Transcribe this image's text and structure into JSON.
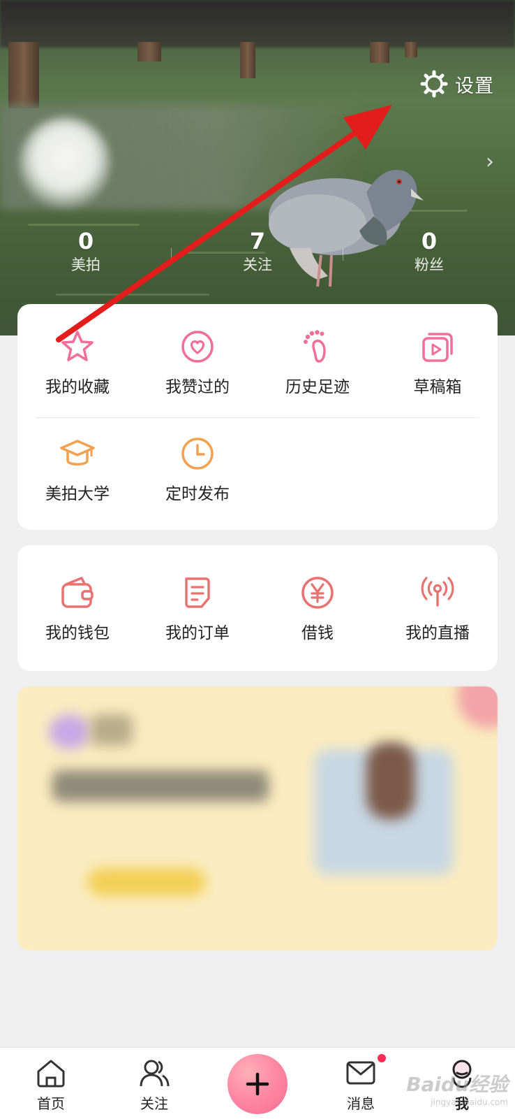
{
  "header": {
    "settings_label": "设置",
    "stats": [
      {
        "value": "0",
        "label": "美拍"
      },
      {
        "value": "7",
        "label": "关注"
      },
      {
        "value": "0",
        "label": "粉丝"
      }
    ]
  },
  "card1": {
    "row1": [
      {
        "label": "我的收藏",
        "icon": "star-icon"
      },
      {
        "label": "我赞过的",
        "icon": "heart-icon"
      },
      {
        "label": "历史足迹",
        "icon": "footprint-icon"
      },
      {
        "label": "草稿箱",
        "icon": "draft-video-icon"
      }
    ],
    "row2": [
      {
        "label": "美拍大学",
        "icon": "graduation-cap-icon"
      },
      {
        "label": "定时发布",
        "icon": "clock-icon"
      }
    ]
  },
  "card2": {
    "items": [
      {
        "label": "我的钱包",
        "icon": "wallet-icon"
      },
      {
        "label": "我的订单",
        "icon": "order-icon"
      },
      {
        "label": "借钱",
        "icon": "yen-icon"
      },
      {
        "label": "我的直播",
        "icon": "live-broadcast-icon"
      }
    ]
  },
  "tabbar": {
    "tabs": [
      {
        "label": "首页",
        "icon": "home-icon"
      },
      {
        "label": "关注",
        "icon": "follow-icon"
      },
      {
        "label": "",
        "icon": "plus-icon"
      },
      {
        "label": "消息",
        "icon": "message-icon"
      },
      {
        "label": "我",
        "icon": "me-icon"
      }
    ]
  },
  "colors": {
    "pink_accent": "#f06e9a",
    "orange_accent": "#f3a14f",
    "red_accent": "#e8726f",
    "annotation_arrow": "#e31c1c"
  },
  "watermark": {
    "brand": "Baidu经验",
    "url": "jingyan.baidu.com"
  }
}
